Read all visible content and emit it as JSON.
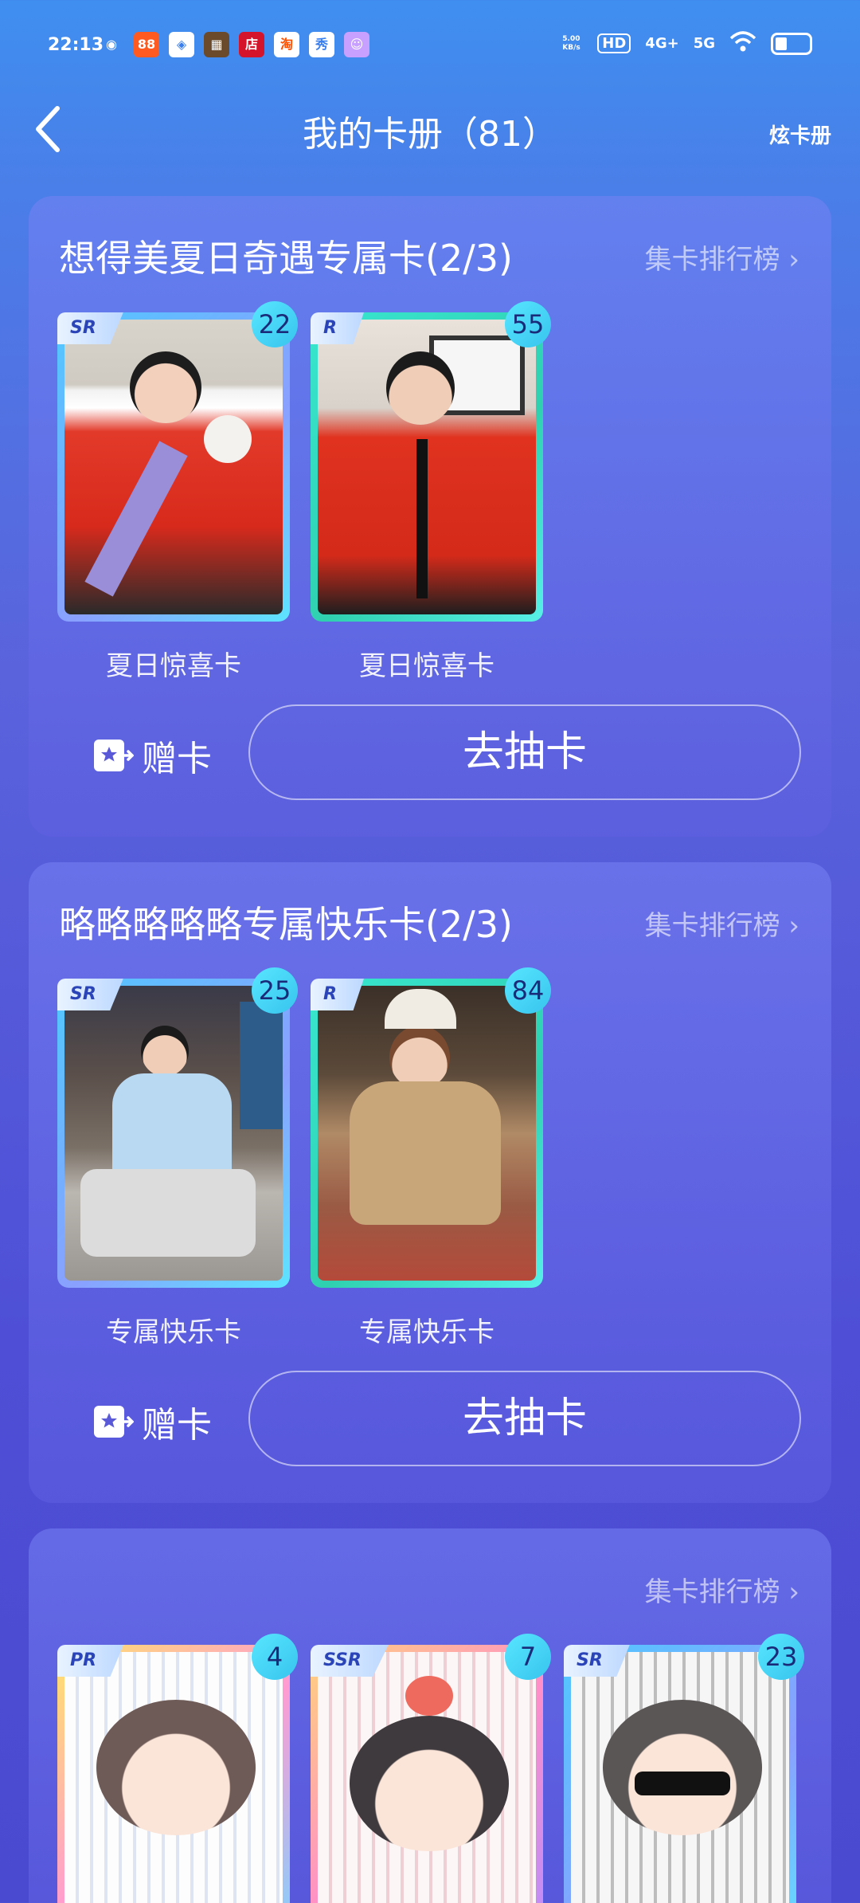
{
  "status_bar": {
    "time": "22:13",
    "apps": [
      "weibo",
      "taobao",
      "baidu",
      "game",
      "店",
      "淘",
      "秀",
      "avatar"
    ],
    "speed": "5.00 KB/s",
    "hd": "HD",
    "net1": "4G+",
    "net2": "5G"
  },
  "header": {
    "title": "我的卡册（81）",
    "right_action": "炫卡册"
  },
  "collections": [
    {
      "title": "想得美夏日奇遇专属卡(2/3)",
      "rank_label": "集卡排行榜",
      "cards": [
        {
          "rarity": "SR",
          "count": "22",
          "name": "夏日惊喜卡"
        },
        {
          "rarity": "R",
          "count": "55",
          "name": "夏日惊喜卡"
        }
      ],
      "gift_label": "赠卡",
      "draw_label": "去抽卡"
    },
    {
      "title": "略略略略略专属快乐卡(2/3)",
      "rank_label": "集卡排行榜",
      "cards": [
        {
          "rarity": "SR",
          "count": "25",
          "name": "专属快乐卡"
        },
        {
          "rarity": "R",
          "count": "84",
          "name": "专属快乐卡"
        }
      ],
      "gift_label": "赠卡",
      "draw_label": "去抽卡"
    },
    {
      "title": "",
      "rank_label": "集卡排行榜",
      "cards": [
        {
          "rarity": "PR",
          "count": "4"
        },
        {
          "rarity": "SSR",
          "count": "7"
        },
        {
          "rarity": "SR",
          "count": "23"
        }
      ]
    }
  ],
  "colors": {
    "accent_badge": "#4fdcff",
    "panel_bg": "#6a6ae6"
  }
}
